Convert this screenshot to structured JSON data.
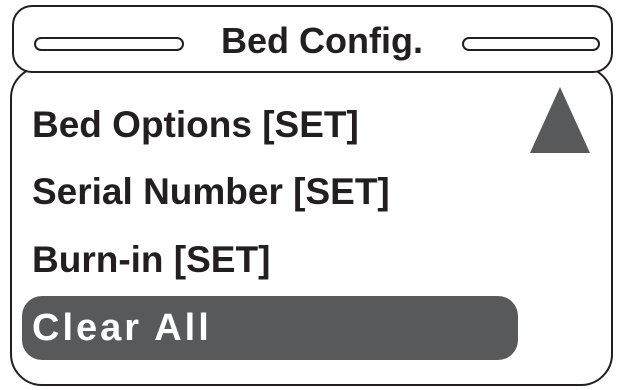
{
  "header": {
    "title": "Bed Config."
  },
  "menu": {
    "items": [
      {
        "label": "Bed Options [SET]"
      },
      {
        "label": "Serial Number [SET]"
      },
      {
        "label": "Burn-in [SET]"
      }
    ],
    "selected_item": {
      "label": "Clear All"
    },
    "scroll_up_icon": "triangle-up"
  },
  "colors": {
    "outline": "#231f20",
    "selected_background": "#58595b",
    "selected_text": "#ffffff",
    "background": "#ffffff"
  }
}
